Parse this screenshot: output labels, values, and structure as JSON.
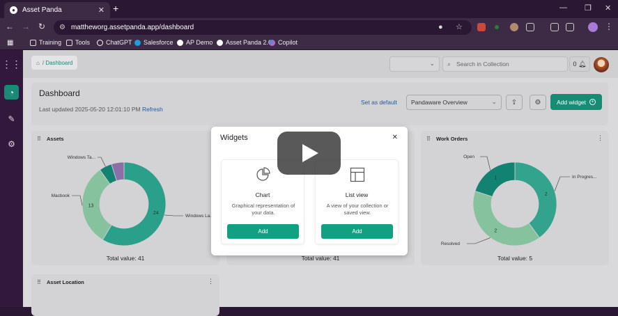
{
  "browser": {
    "tab_title": "Asset Panda",
    "tab_close": "✕",
    "new_tab": "+",
    "url": "mattheworg.assetpanda.app/dashboard",
    "win_min": "—",
    "win_restore": "❐",
    "win_close": "✕",
    "bookmarks": [
      {
        "label": "Training",
        "icon": "folder-icon"
      },
      {
        "label": "Tools",
        "icon": "folder-icon"
      },
      {
        "label": "ChatGPT",
        "icon": "chatgpt-icon"
      },
      {
        "label": "Salesforce",
        "icon": "salesforce-icon"
      },
      {
        "label": "AP Demo",
        "icon": "panda-icon"
      },
      {
        "label": "Asset Panda 2.0",
        "icon": "panda-icon"
      },
      {
        "label": "Copilot",
        "icon": "copilot-icon"
      }
    ]
  },
  "breadcrumb": {
    "current": "Dashboard",
    "separator": "/"
  },
  "search": {
    "placeholder": "Search in Collection"
  },
  "notifications": {
    "count": "0"
  },
  "dashboard": {
    "title": "Dashboard",
    "last_updated_label": "Last updated",
    "last_updated_value": "2025-05-20 12:01:10 PM",
    "refresh_label": "Refresh",
    "set_default_label": "Set as default",
    "view_selected": "Pandaware Overview",
    "add_widget_label": "Add widget"
  },
  "cards": {
    "assets": {
      "title": "Assets",
      "total": "Total value: 41"
    },
    "middle": {
      "total": "Total value: 41"
    },
    "work_orders": {
      "title": "Work Orders",
      "total": "Total value: 5"
    },
    "asset_location": {
      "title": "Asset Location"
    }
  },
  "modal": {
    "title": "Widgets",
    "close": "✕",
    "options": [
      {
        "name": "Chart",
        "desc": "Graphical representation of your data.",
        "button": "Add"
      },
      {
        "name": "List view",
        "desc": "A view of your collection or saved view.",
        "button": "Add"
      }
    ]
  },
  "chart_data": [
    {
      "type": "pie",
      "title": "Assets",
      "categories": [
        "Windows La...",
        "Macbook",
        "Windows Ta...",
        ""
      ],
      "values": [
        24,
        13,
        2,
        2
      ],
      "data_labels": [
        "24",
        "13",
        "",
        ""
      ],
      "colors": [
        "#2a9f89",
        "#86c29d",
        "#128372",
        "#8a6fa8"
      ]
    },
    {
      "type": "pie",
      "title": "Work Orders",
      "categories": [
        "In Progres...",
        "Resolved",
        "Open"
      ],
      "values": [
        2,
        2,
        1
      ],
      "data_labels": [
        "2",
        "2",
        "1"
      ],
      "colors": [
        "#34a38e",
        "#86c29d",
        "#128372"
      ]
    }
  ]
}
